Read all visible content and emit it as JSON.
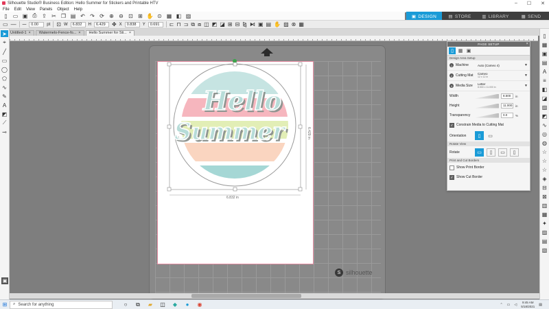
{
  "window": {
    "title": "Silhouette Studio® Business Edition: Hello Summer for Stickers and Printable HTV",
    "controls": [
      "–",
      "☐",
      "✕"
    ]
  },
  "menu": [
    "File",
    "Edit",
    "View",
    "Panels",
    "Object",
    "Help"
  ],
  "nav_tabs": [
    {
      "label": "DESIGN",
      "active": true
    },
    {
      "label": "STORE",
      "active": false
    },
    {
      "label": "LIBRARY",
      "active": false
    },
    {
      "label": "SEND",
      "active": false
    }
  ],
  "properties": {
    "stroke_width": "0.00",
    "stroke_unit": "pt",
    "w_label": "W",
    "w_value": "6.832",
    "h_label": "H",
    "h_value": "6.429",
    "x_label": "X",
    "x_value": "0.838",
    "y_label": "Y",
    "y_value": "0.691"
  },
  "doc_tabs": [
    {
      "label": "Untitled-1",
      "active": false
    },
    {
      "label": "Watermelo-Fence-fo...",
      "active": false
    },
    {
      "label": "Hello Summer for Sti...",
      "active": true
    }
  ],
  "design": {
    "text_line1": "Hello",
    "text_line2": "Summer",
    "width_dim": "6.832 in",
    "height_dim": "6.429 in",
    "stripes": [
      {
        "color": "#c6e4e2"
      },
      {
        "color": "#f6b6be"
      },
      {
        "color": "#e2eeb6"
      },
      {
        "color": "#fad5c0"
      },
      {
        "color": "#a5d7d5"
      }
    ]
  },
  "brand": "silhouette",
  "panel": {
    "title": "PAGE SETUP",
    "section": "Design Area Setup",
    "machine_label": "Machine",
    "machine_value": "Auto (Cameo 4)",
    "cutting_mat_label": "Cutting Mat",
    "cutting_mat_value": "Cameo",
    "cutting_mat_sub": "12 x 12 in",
    "media_size_label": "Media Size",
    "media_size_value": "Letter",
    "media_size_sub": "8.500 x 11.000 in",
    "width_label": "Width",
    "width_value": "8.500",
    "height_label": "Height",
    "height_value": "11.000",
    "unit_in": "in",
    "transparency_label": "Transparency",
    "transparency_value": "0.0",
    "unit_percent": "%",
    "constrain_label": "Constrain Media to Cutting Mat",
    "orientation_label": "Orientation",
    "rotate_view_header": "Rotate View",
    "rotate_label": "Rotate",
    "print_cut_header": "Print and Cut Borders",
    "show_print_border": "Show Print Border",
    "show_cut_border": "Show Cut Border"
  },
  "taskbar": {
    "search_placeholder": "Search for anything",
    "time": "9:45 AM",
    "date": "5/18/2021"
  }
}
